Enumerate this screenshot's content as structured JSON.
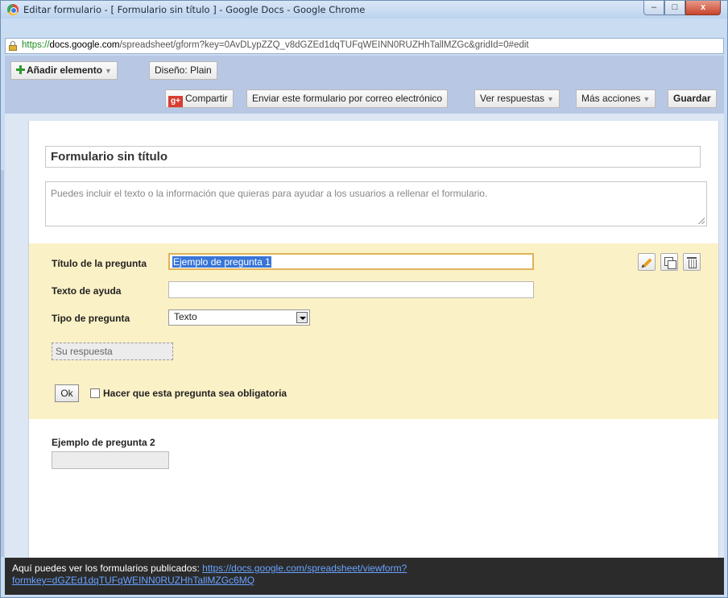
{
  "window": {
    "title": "Editar formulario - [ Formulario sin título ] - Google Docs - Google Chrome",
    "controls": {
      "minimize": "–",
      "maximize": "□",
      "close": "x"
    }
  },
  "address_bar": {
    "scheme": "https://",
    "host": "docs.google.com",
    "path": "/spreadsheet/gform?key=0AvDLypZZQ_v8dGZEd1dqTUFqWEINN0RUZHhTallMZGc&gridId=0#edit"
  },
  "toolbar": {
    "add_item": "Añadir elemento",
    "theme": "Diseño: Plain",
    "share": "Compartir",
    "share_icon_text": "g+",
    "email_form": "Enviar este formulario por correo electrónico",
    "view_responses": "Ver respuestas",
    "more_actions": "Más acciones",
    "save": "Guardar"
  },
  "form": {
    "title": "Formulario sin título",
    "description_placeholder": "Puedes incluir el texto o la información que quieras para ayudar a los usuarios a rellenar el formulario."
  },
  "question_editor": {
    "title_label": "Título de la pregunta",
    "title_value": "Ejemplo de pregunta 1",
    "help_label": "Texto de ayuda",
    "help_value": "",
    "type_label": "Tipo de pregunta",
    "type_value": "Texto",
    "answer_preview": "Su respuesta",
    "ok": "Ok",
    "required_label": "Hacer que esta pregunta sea obligatoria",
    "required_checked": false
  },
  "question2": {
    "label": "Ejemplo de pregunta 2"
  },
  "footer": {
    "text": "Aquí puedes ver los formularios publicados:",
    "link_line1": "https://docs.google.com/spreadsheet/viewform?",
    "link_line2": "formkey=dGZEd1dqTUFqWEINN0RUZHhTallMZGc6MQ"
  },
  "colors": {
    "question_panel_bg": "#fbf1c6",
    "toolbar_bg": "#b8c8e4",
    "footer_bg": "#2b2b2b",
    "link": "#68a3ff",
    "selection": "#3875d7"
  }
}
